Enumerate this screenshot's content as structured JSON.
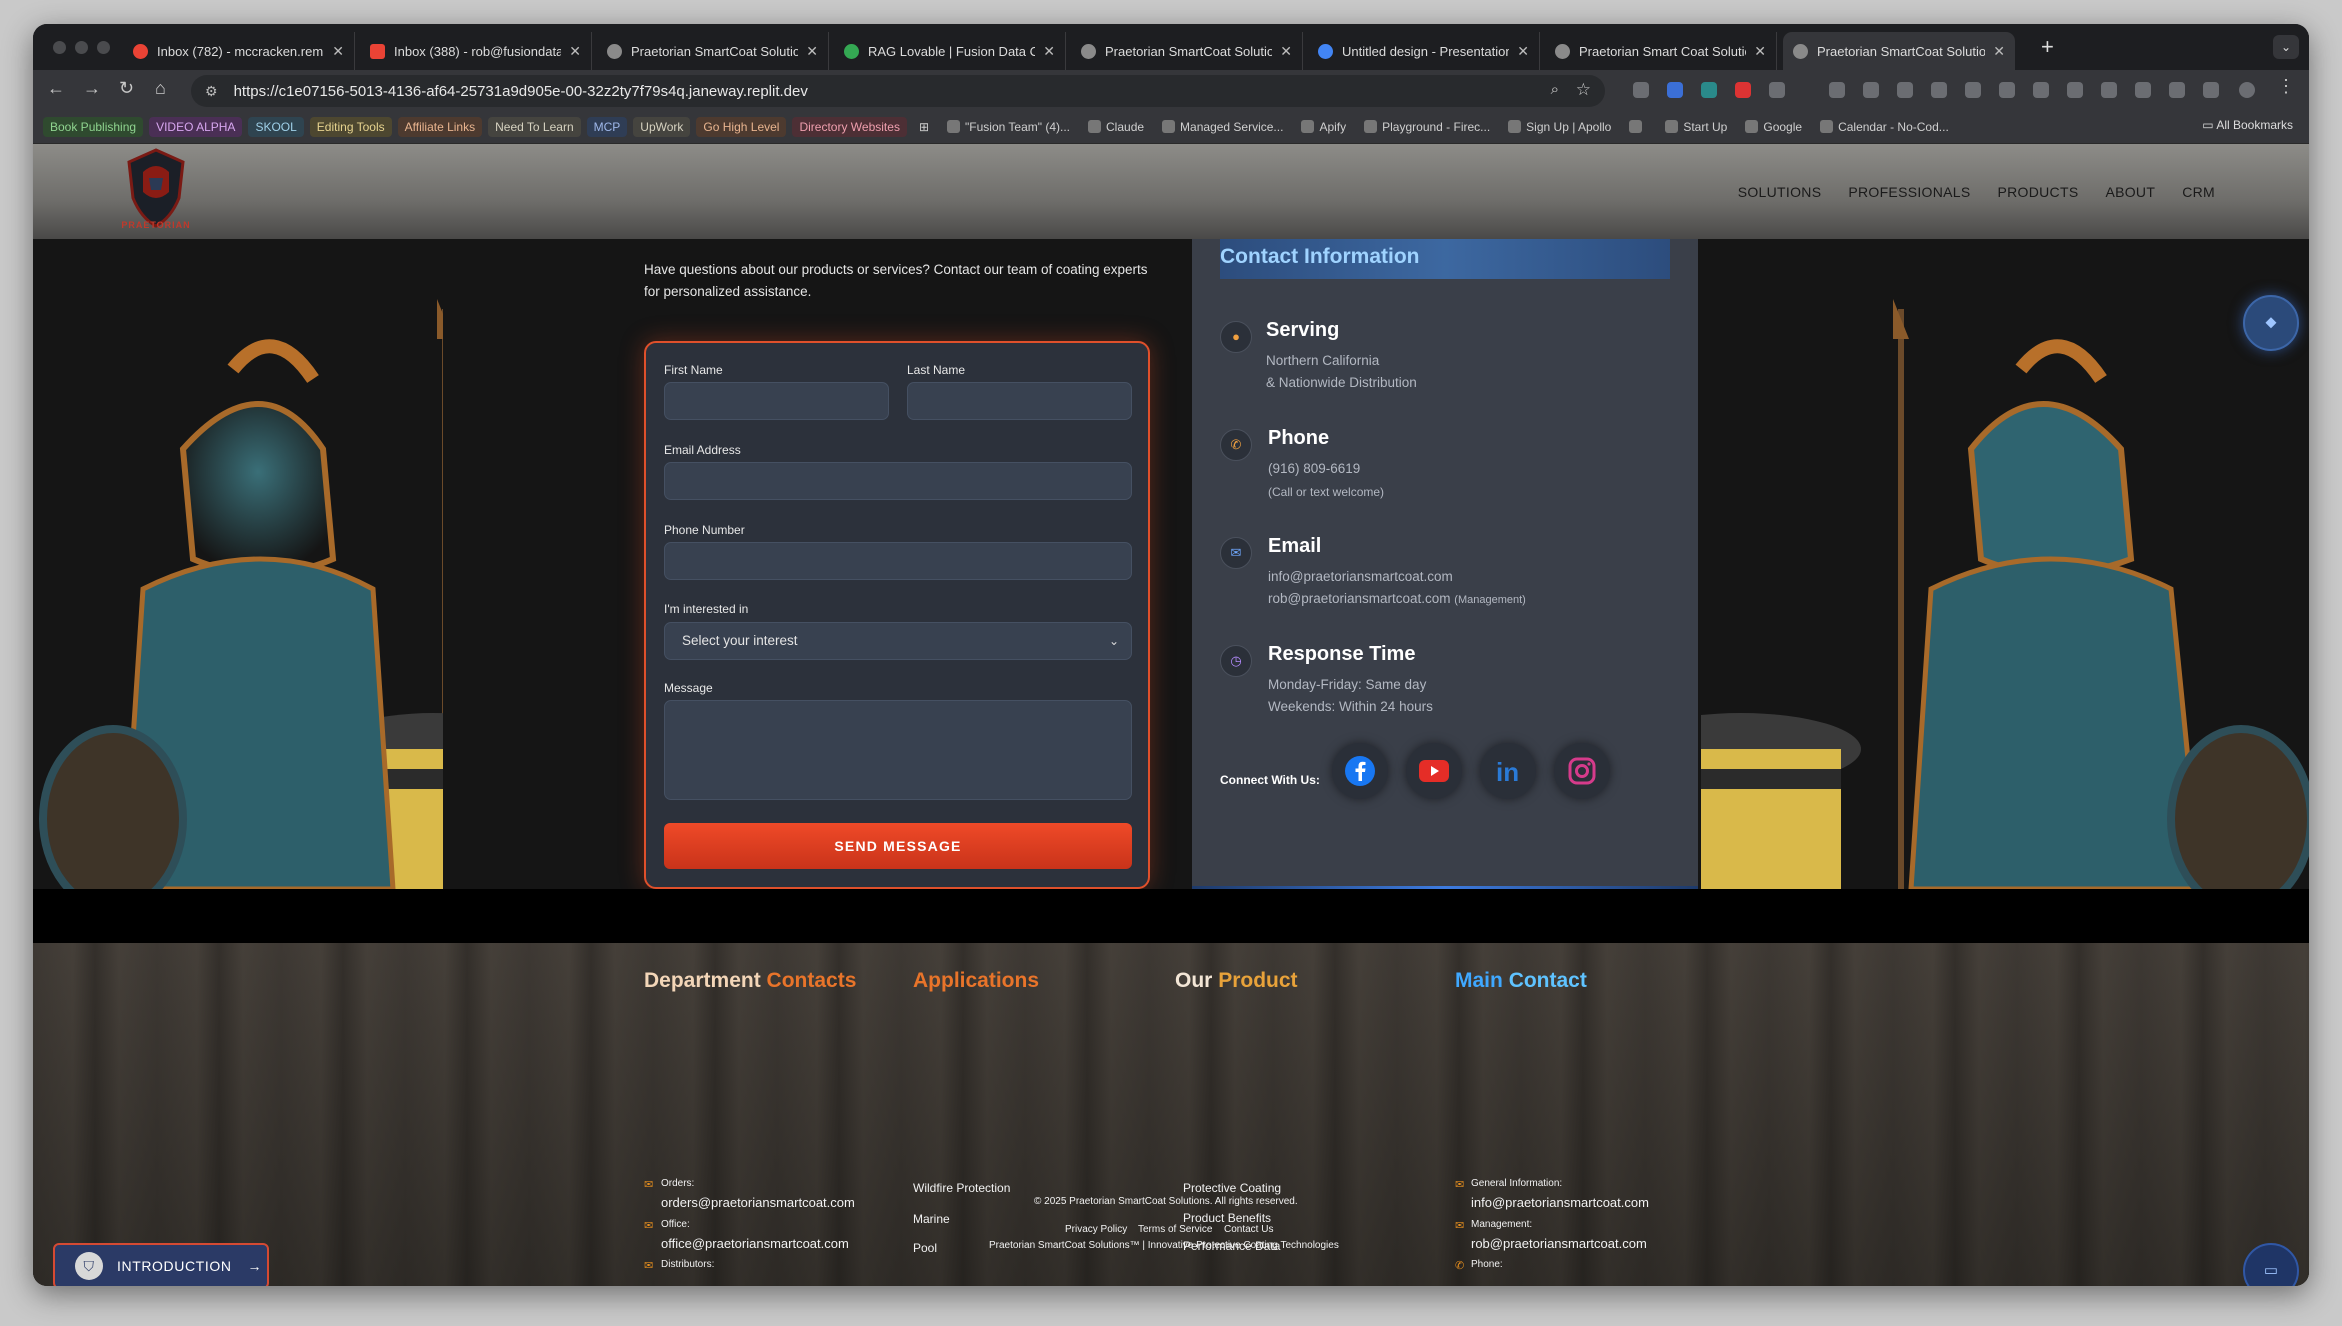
{
  "browser": {
    "tabs": [
      {
        "title": "Inbox (782) - mccracken.rem",
        "fav": "#ea4335"
      },
      {
        "title": "Inbox (388) - rob@fusiondata",
        "fav": "#ea4335"
      },
      {
        "title": "Praetorian SmartCoat Solution",
        "fav": "#9aa0a6"
      },
      {
        "title": "RAG Lovable | Fusion Data Co",
        "fav": "#34a853"
      },
      {
        "title": "Praetorian SmartCoat Solution",
        "fav": "#9aa0a6"
      },
      {
        "title": "Untitled design - Presentation",
        "fav": "#4285f4"
      },
      {
        "title": "Praetorian Smart Coat Solutio",
        "fav": "#9aa0a6"
      },
      {
        "title": "Praetorian SmartCoat Solutio",
        "fav": "#9aa0a6"
      }
    ],
    "url": "https://c1e07156-5013-4136-af64-25731a9d905e-00-32z2ty7f79s4q.janeway.replit.dev",
    "bookmark_groups": [
      {
        "label": "Book Publishing",
        "bg": "#2f4a2f",
        "fg": "#8fd48f"
      },
      {
        "label": "VIDEO ALPHA",
        "bg": "#4a2f55",
        "fg": "#d7a6ef"
      },
      {
        "label": "SKOOL",
        "bg": "#2f4450",
        "fg": "#9fd0e8"
      },
      {
        "label": "Editing Tools",
        "bg": "#4d4730",
        "fg": "#e6d38f"
      },
      {
        "label": "Affiliate Links",
        "bg": "#4d3a2f",
        "fg": "#e8b48f"
      },
      {
        "label": "Need To Learn",
        "bg": "#45443f",
        "fg": "#d6d2c0"
      },
      {
        "label": "MCP",
        "bg": "#2f3d55",
        "fg": "#9fb8ea"
      },
      {
        "label": "UpWork",
        "bg": "#45443f",
        "fg": "#d6d2c0"
      },
      {
        "label": "Go High Level",
        "bg": "#4d3a2f",
        "fg": "#e8b48f"
      },
      {
        "label": "Directory Websites",
        "bg": "#4d2f35",
        "fg": "#ef9fae"
      }
    ],
    "bookmarks": [
      "\"Fusion Team\" (4)...",
      "Claude",
      "Managed Service...",
      "Apify",
      "Playground - Firec...",
      "Sign Up | Apollo",
      "",
      "Start Up",
      "Google",
      "Calendar - No-Cod..."
    ],
    "all_bookmarks": "All Bookmarks"
  },
  "site": {
    "logo_text": "PRAETORIAN",
    "nav": [
      "SOLUTIONS",
      "PROFESSIONALS",
      "PRODUCTS",
      "ABOUT",
      "CRM"
    ],
    "intro": "Have questions about our products or services? Contact our team of coating experts for personalized assistance.",
    "form": {
      "first_name": "First Name",
      "last_name": "Last Name",
      "email": "Email Address",
      "phone": "Phone Number",
      "interest": "I'm interested in",
      "interest_value": "Select your interest",
      "message": "Message",
      "send": "SEND MESSAGE"
    },
    "contact": {
      "title": "Contact Information",
      "serving_h": "Serving",
      "serving_1": "Northern California",
      "serving_2": "& Nationwide Distribution",
      "phone_h": "Phone",
      "phone_1": "(916) 809-6619",
      "phone_2": "(Call or text welcome)",
      "email_h": "Email",
      "email_1": "info@praetoriansmartcoat.com",
      "email_2": "rob@praetoriansmartcoat.com",
      "email_2_note": "(Management)",
      "response_h": "Response Time",
      "response_1": "Monday-Friday: Same day",
      "response_2": "Weekends: Within 24 hours",
      "connect": "Connect With Us:"
    },
    "footer": {
      "dept_a": "Department",
      "dept_b": "Contacts",
      "apps": "Applications",
      "prod_a": "Our",
      "prod_b": "Product",
      "main_a": "Main",
      "main_b": "Contact",
      "orders_label": "Orders:",
      "orders_email": "orders@praetoriansmartcoat.com",
      "office_label": "Office:",
      "office_email": "office@praetoriansmartcoat.com",
      "distributors_label": "Distributors:",
      "apps_1": "Wildfire Protection",
      "apps_2": "Marine",
      "apps_3": "Pool",
      "prod_1": "Protective Coating",
      "prod_2": "Product Benefits",
      "prod_3": "Performance Data",
      "general_label": "General Information:",
      "general_email": "info@praetoriansmartcoat.com",
      "mgmt_label": "Management:",
      "mgmt_email": "rob@praetoriansmartcoat.com",
      "phone_label": "Phone:",
      "copyright": "© 2025 Praetorian SmartCoat Solutions. All rights reserved.",
      "privacy": "Privacy Policy",
      "terms": "Terms of Service",
      "contact_us": "Contact Us",
      "tagline": "Praetorian SmartCoat Solutions™ | Innovative Protective Coating Technologies"
    },
    "intro_button": "INTRODUCTION"
  }
}
